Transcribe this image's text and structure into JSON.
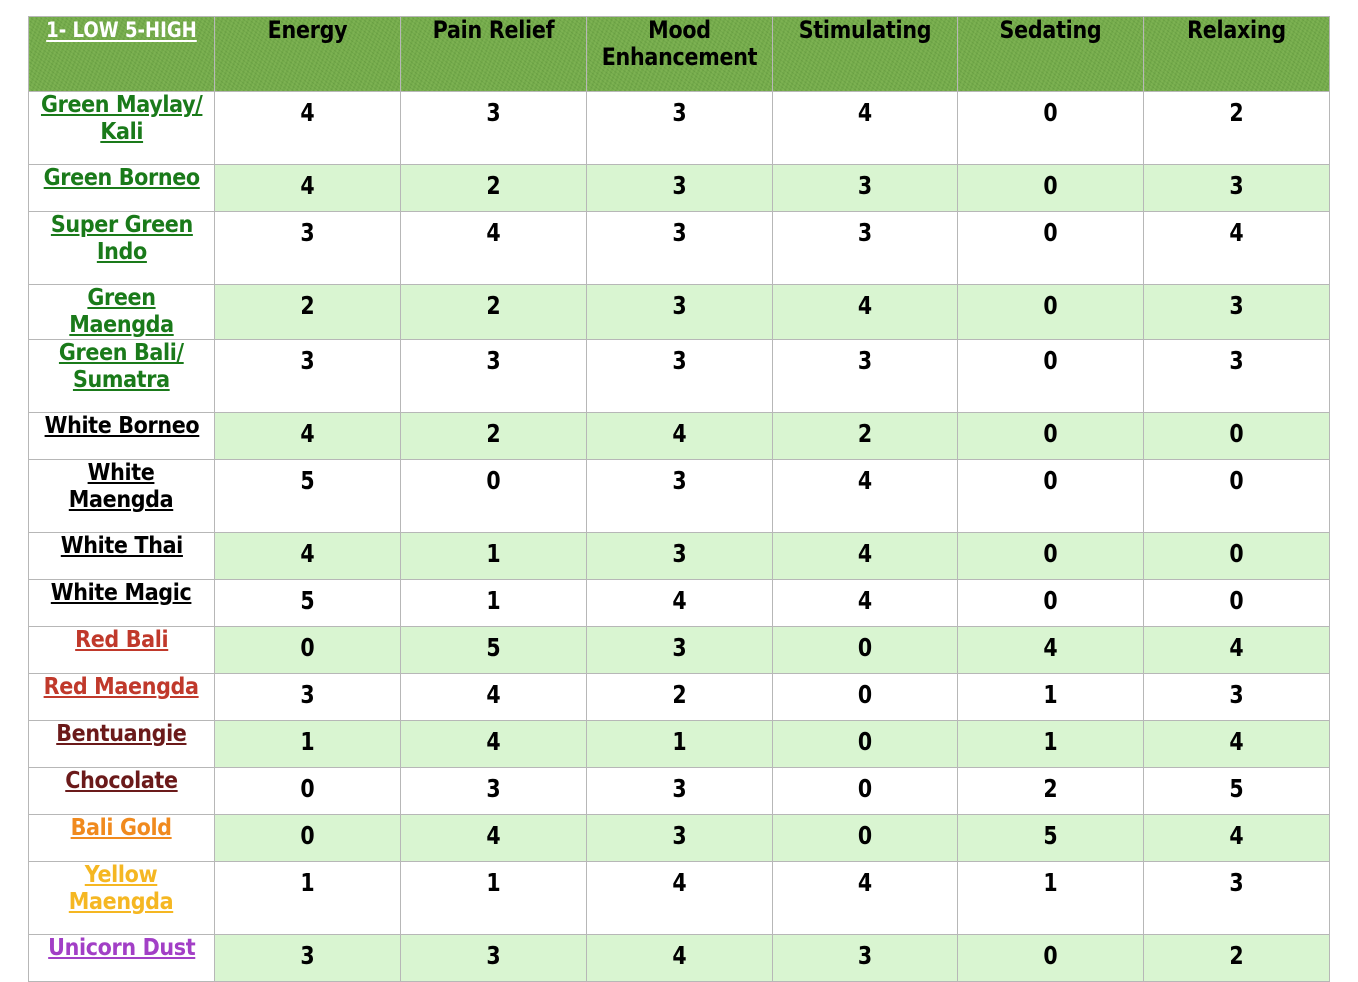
{
  "table": {
    "scale_header": "1- LOW 5-HIGH",
    "columns": [
      {
        "label": "1- LOW 5-HIGH",
        "name": "scale"
      },
      {
        "label": "Energy",
        "name": "energy"
      },
      {
        "label": "Pain Relief",
        "name": "pain-relief"
      },
      {
        "label": "Mood\nEnhancement",
        "name": "mood-enhancement"
      },
      {
        "label": "Stimulating",
        "name": "stimulating"
      },
      {
        "label": "Sedating",
        "name": "sedating"
      },
      {
        "label": "Relaxing",
        "name": "relaxing"
      }
    ],
    "colors": {
      "header_green": "#75b544",
      "row_shade_green": "#d9f5d1",
      "grid_line": "#b7b7b7",
      "green_strain": "#1a7a1a",
      "white_strain": "#000000",
      "red_strain": "#c0392b",
      "brown_strain": "#6b1a1a",
      "orange_strain": "#f08a1e",
      "yellow_strain": "#f5b722",
      "purple_strain": "#a23fc6"
    },
    "rows": [
      {
        "strain": "Green Maylay/\nKali",
        "color": "#1a7a1a",
        "tall": true,
        "shaded": false,
        "values": [
          4,
          3,
          3,
          4,
          0,
          2
        ]
      },
      {
        "strain": "Green Borneo",
        "color": "#1a7a1a",
        "tall": false,
        "shaded": true,
        "values": [
          4,
          2,
          3,
          3,
          0,
          3
        ]
      },
      {
        "strain": "Super Green\nIndo",
        "color": "#1a7a1a",
        "tall": true,
        "shaded": false,
        "values": [
          3,
          4,
          3,
          3,
          0,
          4
        ]
      },
      {
        "strain": "Green Maengda",
        "color": "#1a7a1a",
        "tall": false,
        "shaded": true,
        "values": [
          2,
          2,
          3,
          4,
          0,
          3
        ]
      },
      {
        "strain": "Green Bali/\nSumatra",
        "color": "#1a7a1a",
        "tall": true,
        "shaded": false,
        "values": [
          3,
          3,
          3,
          3,
          0,
          3
        ]
      },
      {
        "strain": "White Borneo",
        "color": "#000000",
        "tall": false,
        "shaded": true,
        "values": [
          4,
          2,
          4,
          2,
          0,
          0
        ]
      },
      {
        "strain": "White\nMaengda",
        "color": "#000000",
        "tall": true,
        "shaded": false,
        "values": [
          5,
          0,
          3,
          4,
          0,
          0
        ]
      },
      {
        "strain": "White Thai",
        "color": "#000000",
        "tall": false,
        "shaded": true,
        "values": [
          4,
          1,
          3,
          4,
          0,
          0
        ]
      },
      {
        "strain": "White Magic",
        "color": "#000000",
        "tall": false,
        "shaded": false,
        "values": [
          5,
          1,
          4,
          4,
          0,
          0
        ]
      },
      {
        "strain": "Red Bali",
        "color": "#c0392b",
        "tall": false,
        "shaded": true,
        "values": [
          0,
          5,
          3,
          0,
          4,
          4
        ]
      },
      {
        "strain": "Red Maengda",
        "color": "#c0392b",
        "tall": false,
        "shaded": false,
        "values": [
          3,
          4,
          2,
          0,
          1,
          3
        ]
      },
      {
        "strain": "Bentuangie",
        "color": "#6b1a1a",
        "tall": false,
        "shaded": true,
        "values": [
          1,
          4,
          1,
          0,
          1,
          4
        ]
      },
      {
        "strain": "Chocolate",
        "color": "#6b1a1a",
        "tall": false,
        "shaded": false,
        "values": [
          0,
          3,
          3,
          0,
          2,
          5
        ]
      },
      {
        "strain": "Bali Gold",
        "color": "#f08a1e",
        "tall": false,
        "shaded": true,
        "values": [
          0,
          4,
          3,
          0,
          5,
          4
        ]
      },
      {
        "strain": "Yellow\nMaengda",
        "color": "#f5b722",
        "tall": true,
        "shaded": false,
        "values": [
          1,
          1,
          4,
          4,
          1,
          3
        ]
      },
      {
        "strain": "Unicorn Dust",
        "color": "#a23fc6",
        "tall": false,
        "shaded": true,
        "values": [
          3,
          3,
          4,
          3,
          0,
          2
        ]
      }
    ]
  }
}
